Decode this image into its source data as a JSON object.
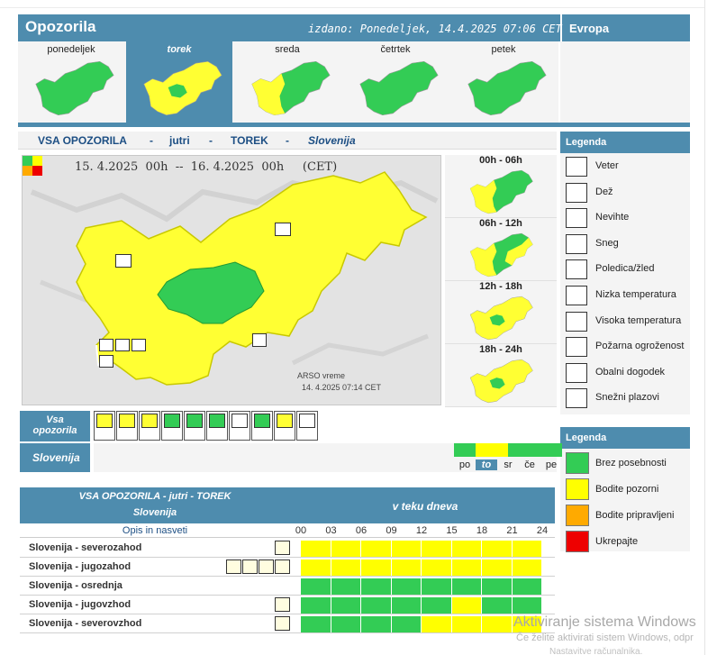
{
  "header": {
    "title": "Opozorila",
    "issued": "izdano: Ponedeljek, 14.4.2025 07:06 CET",
    "europe": "Evropa"
  },
  "days": [
    {
      "label": "ponedeljek",
      "selected": false
    },
    {
      "label": "torek",
      "selected": true
    },
    {
      "label": "sreda",
      "selected": false
    },
    {
      "label": "četrtek",
      "selected": false
    },
    {
      "label": "petek",
      "selected": false
    }
  ],
  "section": {
    "all": "VSA OPOZORILA",
    "sep": "-",
    "tomorrow": "jutri",
    "day": "TOREK",
    "country": "Slovenija"
  },
  "map": {
    "date_range": "15. 4.2025  00h  --  16. 4.2025  00h     (CET)",
    "credit_line1": "ARSO vreme",
    "credit_line2": "14. 4.2025  07:14 CET"
  },
  "periods": [
    "00h - 06h",
    "06h - 12h",
    "12h - 18h",
    "18h - 24h"
  ],
  "legend_types": {
    "title": "Legenda",
    "items": [
      {
        "label": "Veter",
        "icon": "wind-icon"
      },
      {
        "label": "Dež",
        "icon": "rain-icon"
      },
      {
        "label": "Nevihte",
        "icon": "storm-icon"
      },
      {
        "label": "Sneg",
        "icon": "snow-icon"
      },
      {
        "label": "Poledica/žled",
        "icon": "ice-icon"
      },
      {
        "label": "Nizka temperatura",
        "icon": "low-temperature-icon"
      },
      {
        "label": "Visoka temperatura",
        "icon": "high-temperature-icon"
      },
      {
        "label": "Požarna ogroženost",
        "icon": "fire-icon"
      },
      {
        "label": "Obalni dogodek",
        "icon": "coastal-icon"
      },
      {
        "label": "Snežni plazovi",
        "icon": "avalanche-icon"
      }
    ]
  },
  "legend_levels": {
    "title": "Legenda",
    "items": [
      {
        "label": "Brez posebnosti",
        "color": "#33cc55"
      },
      {
        "label": "Bodite pozorni",
        "color": "#ffff00"
      },
      {
        "label": "Bodite pripravljeni",
        "color": "#ffaa00"
      },
      {
        "label": "Ukrepajte",
        "color": "#ee0000"
      }
    ]
  },
  "warn_strip": {
    "label_line1": "Vsa",
    "label_line2": "opozorila"
  },
  "region_strip": {
    "label": "Slovenija",
    "days": [
      "po",
      "to",
      "sr",
      "če",
      "pe"
    ]
  },
  "table": {
    "head_line1": "VSA OPOZORILA - jutri - TOREK",
    "head_line2": "Slovenija",
    "head_right": "v teku dneva",
    "opis": "Opis in nasveti",
    "hours": [
      "00",
      "03",
      "06",
      "09",
      "12",
      "15",
      "18",
      "21",
      "24"
    ],
    "rows": [
      {
        "name": "Slovenija - severozahod",
        "icons": [
          "rain-icon"
        ],
        "levels": [
          1,
          1,
          1,
          1,
          1,
          1,
          1,
          1
        ]
      },
      {
        "name": "Slovenija - jugozahod",
        "icons": [
          "wind-icon",
          "rain-icon",
          "storm-icon",
          "coastal-icon"
        ],
        "levels": [
          1,
          1,
          1,
          1,
          1,
          1,
          1,
          1
        ]
      },
      {
        "name": "Slovenija - osrednja",
        "icons": [],
        "levels": [
          0,
          0,
          0,
          0,
          0,
          0,
          0,
          0
        ]
      },
      {
        "name": "Slovenija - jugovzhod",
        "icons": [
          "storm-icon"
        ],
        "levels": [
          0,
          0,
          0,
          0,
          0,
          1,
          0,
          0
        ]
      },
      {
        "name": "Slovenija - severovzhod",
        "icons": [
          "wind-icon"
        ],
        "levels": [
          0,
          0,
          0,
          0,
          1,
          1,
          1,
          1
        ]
      }
    ]
  },
  "watermark": {
    "line1": "Aktiviranje sistema Windows",
    "line2": "Če želite aktivirati sistem Windows, odpr",
    "line3": "Nastavitve računalnika."
  },
  "colors": {
    "accent": "#4e8cae",
    "green": "#33cc55",
    "yellow": "#ffff00"
  }
}
